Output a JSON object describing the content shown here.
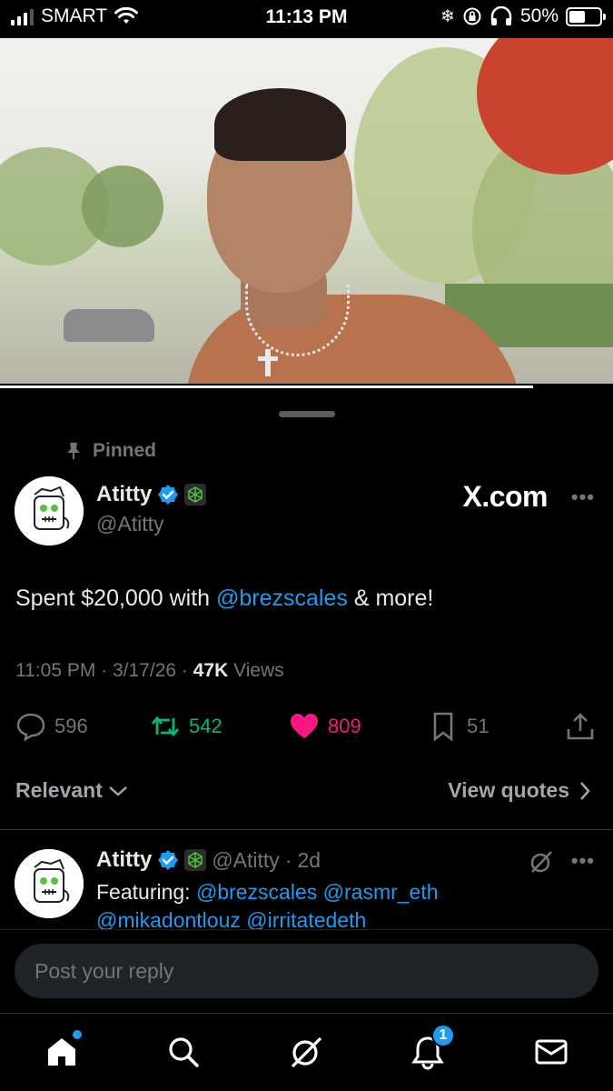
{
  "status_bar": {
    "carrier": "SMART",
    "time": "11:13 PM",
    "battery": "50%",
    "battery_level": 0.5,
    "icons": [
      "signal-icon",
      "wifi-icon",
      "snowflake-icon",
      "orientation-lock-icon",
      "headphones-icon",
      "battery-icon"
    ]
  },
  "video": {
    "description_icon": "video-thumbnail",
    "progress": 0.87
  },
  "tweet": {
    "pinned_label": "Pinned",
    "author_name": "Atitty",
    "author_handle": "@Atitty",
    "source": "X.com",
    "text_before": "Spent $20,000 with ",
    "mention": "@brezscales",
    "text_after": " & more!",
    "timestamp": "11:05 PM · 3/17/26 · ",
    "views_count": "47K",
    "views_label": " Views",
    "replies": "596",
    "reposts": "542",
    "likes": "809",
    "bookmarks": "51"
  },
  "filters": {
    "sort_label": "Relevant",
    "quotes_label": "View quotes"
  },
  "reply": {
    "author_name": "Atitty",
    "author_handle": "@Atitty",
    "age": "2d",
    "separator": "·",
    "prefix": "Featuring: ",
    "mention1": "@brezscales",
    "mention2": "@rasmr_eth",
    "mention3": "@mikadontlouz",
    "mention4": "@irritatedeth"
  },
  "composer": {
    "placeholder": "Post your reply"
  },
  "nav": {
    "notifications_badge": "1"
  },
  "colors": {
    "accent": "#1d9bf0",
    "repost": "#00ba7c",
    "like": "#f91880",
    "muted": "#71767b"
  }
}
